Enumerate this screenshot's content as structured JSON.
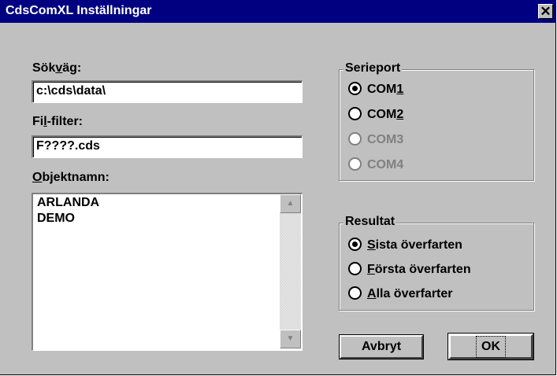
{
  "window": {
    "title": "CdsComXL Inställningar",
    "close_glyph": "✕"
  },
  "path": {
    "label_pre": "Sök",
    "label_u": "v",
    "label_post": "äg:",
    "value": "c:\\cds\\data\\"
  },
  "filter": {
    "label_pre": "Fi",
    "label_u": "l",
    "label_post": "-filter:",
    "value": "F????.cds"
  },
  "objects": {
    "label_u": "O",
    "label_post": "bjektnamn:",
    "items": [
      "ARLANDA",
      "DEMO"
    ]
  },
  "serialport": {
    "title": "Serieport",
    "options": [
      {
        "pre": "COM",
        "u": "1",
        "selected": true,
        "disabled": false
      },
      {
        "pre": "COM",
        "u": "2",
        "selected": false,
        "disabled": false
      },
      {
        "pre": "COM3",
        "u": "",
        "selected": false,
        "disabled": true
      },
      {
        "pre": "COM4",
        "u": "",
        "selected": false,
        "disabled": true
      }
    ]
  },
  "result": {
    "title": "Resultat",
    "options": [
      {
        "u": "S",
        "post": "ista överfarten",
        "selected": true
      },
      {
        "u": "F",
        "post": "örsta överfarten",
        "selected": false
      },
      {
        "u": "A",
        "post": "lla överfarter",
        "selected": false
      }
    ]
  },
  "buttons": {
    "cancel": "Avbryt",
    "ok": "OK"
  }
}
